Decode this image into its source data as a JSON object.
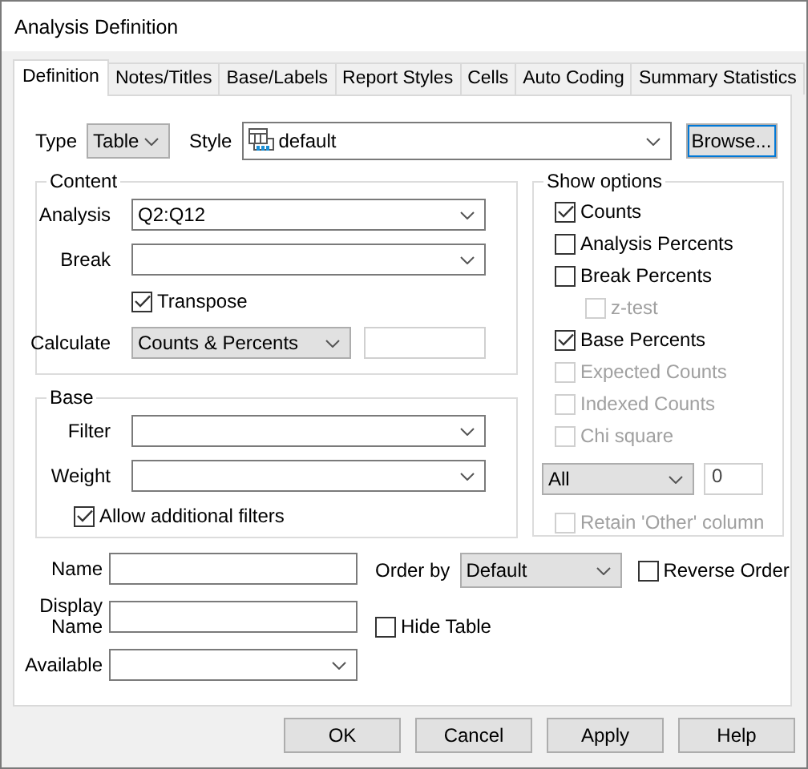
{
  "window": {
    "title": "Analysis Definition"
  },
  "tabs": [
    {
      "label": "Definition",
      "selected": true
    },
    {
      "label": "Notes/Titles",
      "selected": false
    },
    {
      "label": "Base/Labels",
      "selected": false
    },
    {
      "label": "Report Styles",
      "selected": false
    },
    {
      "label": "Cells",
      "selected": false
    },
    {
      "label": "Auto Coding",
      "selected": false
    },
    {
      "label": "Summary Statistics",
      "selected": false
    }
  ],
  "type": {
    "label": "Type",
    "value": "Table"
  },
  "style": {
    "label": "Style",
    "value": "default"
  },
  "browse_button": "Browse...",
  "content": {
    "title": "Content",
    "analysis": {
      "label": "Analysis",
      "value": "Q2:Q12"
    },
    "break": {
      "label": "Break"
    },
    "transpose": {
      "label": "Transpose",
      "checked": true
    },
    "calculate": {
      "label": "Calculate",
      "value": "Counts & Percents"
    }
  },
  "base": {
    "title": "Base",
    "filter": {
      "label": "Filter"
    },
    "weight": {
      "label": "Weight"
    },
    "allow_additional_filters": {
      "label": "Allow additional filters",
      "checked": true
    }
  },
  "show_options": {
    "title": "Show options",
    "options": [
      {
        "label": "Counts",
        "checked": true,
        "disabled": false
      },
      {
        "label": "Analysis Percents",
        "checked": false,
        "disabled": false
      },
      {
        "label": "Break Percents",
        "checked": false,
        "disabled": false,
        "children": [
          {
            "label": "z-test",
            "checked": false,
            "disabled": true
          }
        ]
      },
      {
        "label": "Base Percents",
        "checked": true,
        "disabled": false
      },
      {
        "label": "Expected Counts",
        "checked": false,
        "disabled": true
      },
      {
        "label": "Indexed Counts",
        "checked": false,
        "disabled": true
      },
      {
        "label": "Chi square",
        "checked": false,
        "disabled": true
      }
    ],
    "scope": {
      "value": "All"
    },
    "count_field": {
      "value": "0"
    },
    "retain_other": {
      "label": "Retain 'Other' column",
      "checked": false,
      "disabled": true
    }
  },
  "name": {
    "label": "Name"
  },
  "display_name": {
    "label": "Display Name"
  },
  "available": {
    "label": "Available"
  },
  "order_by": {
    "label": "Order by",
    "value": "Default"
  },
  "reverse_order": {
    "label": "Reverse Order",
    "checked": false
  },
  "hide_table": {
    "label": "Hide Table",
    "checked": false
  },
  "buttons": [
    "OK",
    "Cancel",
    "Apply",
    "Help"
  ]
}
